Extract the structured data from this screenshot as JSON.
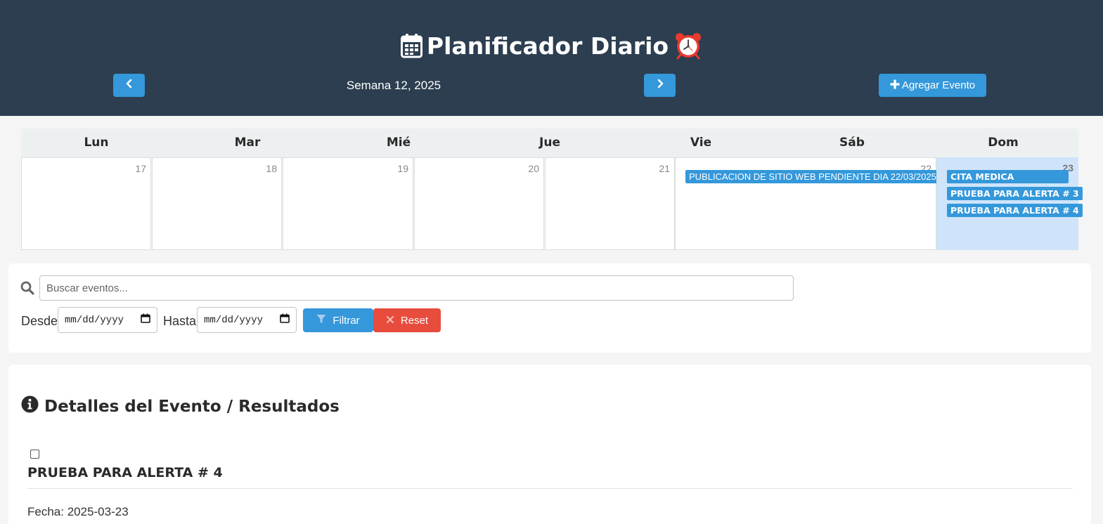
{
  "header": {
    "title": "Planificador Diario",
    "title_icon": "calendar-icon",
    "title_emoji": "alarm-clock-icon",
    "week_label": "Semana 12, 2025",
    "prev_icon": "chevron-left-icon",
    "next_icon": "chevron-right-icon",
    "add_event_label": "Agregar Evento"
  },
  "calendar": {
    "day_headers": [
      "Lun",
      "Mar",
      "Mié",
      "Jue",
      "Vie",
      "Sáb",
      "Dom"
    ],
    "days": [
      "17",
      "18",
      "19",
      "20",
      "21",
      "22",
      "23"
    ],
    "events": {
      "sat": [
        "PUBLICACION DE SITIO WEB PENDIENTE DIA 22/03/2025"
      ],
      "sun": [
        "CITA MEDICA",
        "PRUEBA PARA ALERTA # 3",
        "PRUEBA PARA ALERTA # 4"
      ]
    },
    "today_color": "#cfe4fa",
    "event_color": "#3498db"
  },
  "filter": {
    "search_placeholder": "Buscar eventos...",
    "from_label": "Desde:",
    "to_label": "Hasta:",
    "date_placeholder": "mm/dd/yyyy",
    "filter_label": "Filtrar",
    "reset_label": "Reset"
  },
  "details": {
    "title": "Detalles del Evento / Resultados",
    "event_title": "PRUEBA PARA ALERTA # 4",
    "event_date": "Fecha: 2025-03-23"
  },
  "colors": {
    "header_bg": "#2c3e50",
    "primary": "#3498db",
    "danger": "#e74c3c"
  }
}
